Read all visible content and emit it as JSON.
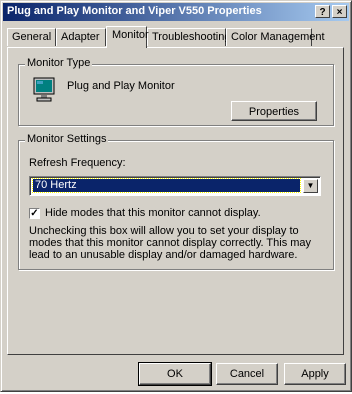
{
  "window": {
    "title": "Plug and Play Monitor and Viper V550 Properties",
    "help_button": "?",
    "close_button": "×"
  },
  "tabs": [
    {
      "label": "General"
    },
    {
      "label": "Adapter"
    },
    {
      "label": "Monitor",
      "active": true
    },
    {
      "label": "Troubleshooting"
    },
    {
      "label": "Color Management"
    }
  ],
  "monitor_type": {
    "group_label": "Monitor Type",
    "monitor_name": "Plug and Play Monitor",
    "icon": "monitor-icon",
    "properties_button": "Properties"
  },
  "monitor_settings": {
    "group_label": "Monitor Settings",
    "refresh_label": "Refresh Frequency:",
    "refresh_value": "70 Hertz",
    "hide_modes_checked": true,
    "hide_modes_label": "Hide modes that this monitor cannot display.",
    "description": "Unchecking this box will allow you to set your display to modes that this monitor cannot display correctly. This may lead to an unusable display and/or damaged hardware."
  },
  "footer": {
    "ok": "OK",
    "cancel": "Cancel",
    "apply": "Apply"
  },
  "colors": {
    "face": "#d4d0c8",
    "titlebar_start": "#0a246a",
    "titlebar_end": "#a6caf0",
    "selection": "#0a246a"
  }
}
